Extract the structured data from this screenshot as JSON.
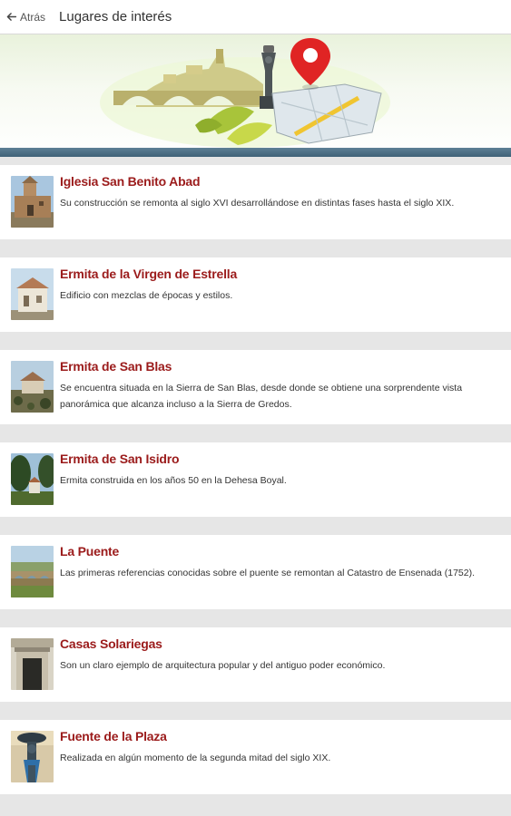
{
  "header": {
    "back_label": "Atrás",
    "title": "Lugares de interés"
  },
  "places": [
    {
      "title": "Iglesia San Benito Abad",
      "description": "Su construcción se remonta al siglo XVI desarrollándose en distintas fases hasta el siglo XIX.",
      "image": "church-photo"
    },
    {
      "title": "Ermita de la Virgen de Estrella",
      "description": "Edificio con mezclas de épocas y estilos.",
      "image": "hermitage-photo"
    },
    {
      "title": "Ermita de San Blas",
      "description": "Se encuentra situada en la Sierra de San Blas, desde donde se obtiene una sorprendente vista panorámica que alcanza incluso a la Sierra de Gredos.",
      "image": "hilltop-hermitage-photo"
    },
    {
      "title": "Ermita de San Isidro",
      "description": "Ermita construida en los años 50 en la Dehesa Boyal.",
      "image": "trees-hermitage-photo"
    },
    {
      "title": "La Puente",
      "description": "Las primeras referencias conocidas sobre el puente se remontan al Catastro de Ensenada (1752).",
      "image": "bridge-photo"
    },
    {
      "title": "Casas Solariegas",
      "description": "Son un claro ejemplo de arquitectura popular y del antiguo poder económico.",
      "image": "manor-door-photo"
    },
    {
      "title": "Fuente de la Plaza",
      "description": "Realizada en algún momento de la segunda mitad del siglo XIX.",
      "image": "fountain-statue-photo"
    }
  ],
  "colors": {
    "title_red": "#9b1b1b",
    "list_background": "#e6e6e6",
    "banner_stripe": "#4a6c82",
    "map_pin": "#e02424"
  }
}
